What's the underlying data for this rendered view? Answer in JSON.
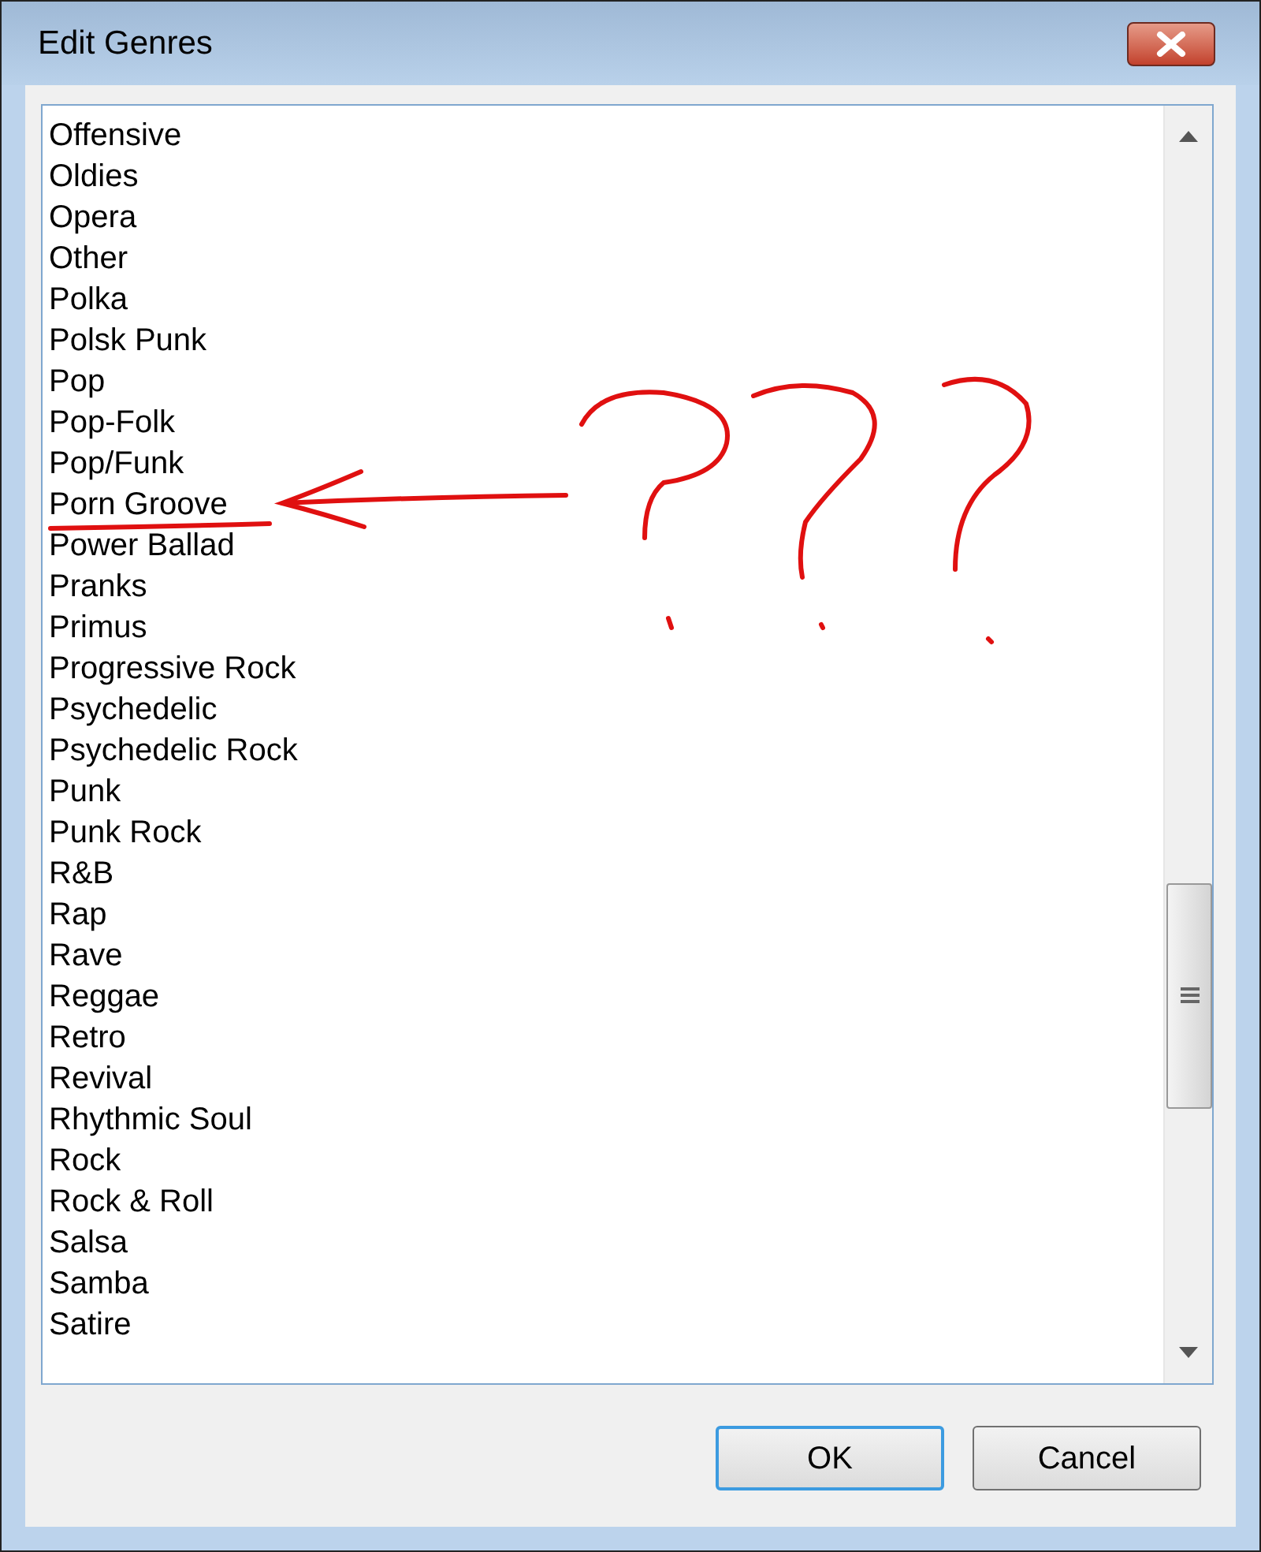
{
  "window": {
    "title": "Edit Genres"
  },
  "genres": [
    "Offensive",
    "Oldies",
    "Opera",
    "Other",
    "Polka",
    "Polsk Punk",
    "Pop",
    "Pop-Folk",
    "Pop/Funk",
    "Porn Groove",
    "Power Ballad",
    "Pranks",
    "Primus",
    "Progressive Rock",
    "Psychedelic",
    "Psychedelic Rock",
    "Punk",
    "Punk Rock",
    "R&B",
    "Rap",
    "Rave",
    "Reggae",
    "Retro",
    "Revival",
    "Rhythmic Soul",
    "Rock",
    "Rock & Roll",
    "Salsa",
    "Samba",
    "Satire"
  ],
  "buttons": [
    {
      "label": "OK",
      "default": true
    },
    {
      "label": "Cancel",
      "default": false
    }
  ]
}
